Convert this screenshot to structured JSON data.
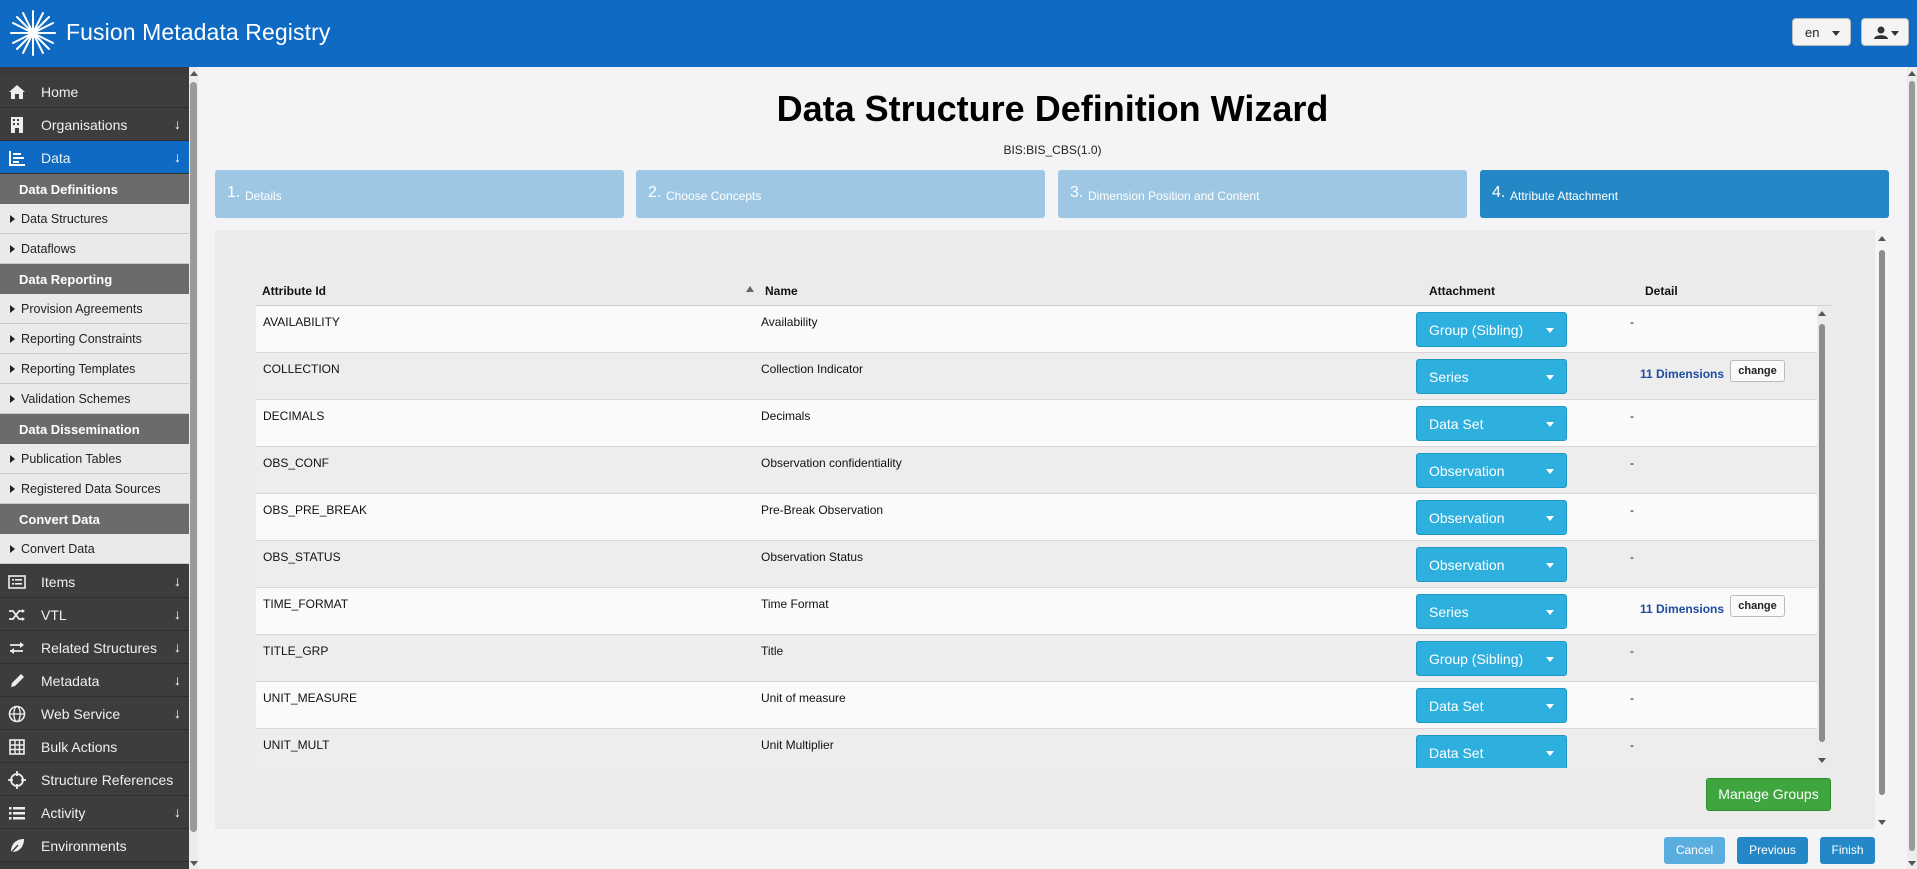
{
  "header": {
    "app_title": "Fusion Metadata Registry",
    "language": "en"
  },
  "sidebar": {
    "items_top": [
      {
        "label": "Home",
        "icon": "home-icon",
        "expand": false
      },
      {
        "label": "Organisations",
        "icon": "building-icon",
        "expand": true
      },
      {
        "label": "Data",
        "icon": "chart-icon",
        "expand": true,
        "active": true
      }
    ],
    "groups": [
      {
        "title": "Data Definitions",
        "items": [
          "Data Structures",
          "Dataflows"
        ]
      },
      {
        "title": "Data Reporting",
        "items": [
          "Provision Agreements",
          "Reporting Constraints",
          "Reporting Templates",
          "Validation Schemes"
        ]
      },
      {
        "title": "Data Dissemination",
        "items": [
          "Publication Tables",
          "Registered Data Sources"
        ]
      },
      {
        "title": "Convert Data",
        "items": [
          "Convert Data"
        ]
      }
    ],
    "items_bottom": [
      {
        "label": "Items",
        "icon": "list-icon",
        "expand": true
      },
      {
        "label": "VTL",
        "icon": "shuffle-icon",
        "expand": true
      },
      {
        "label": "Related Structures",
        "icon": "exchange-icon",
        "expand": true
      },
      {
        "label": "Metadata",
        "icon": "pencil-icon",
        "expand": true
      },
      {
        "label": "Web Service",
        "icon": "globe-icon",
        "expand": true
      },
      {
        "label": "Bulk Actions",
        "icon": "grid-icon",
        "expand": false
      },
      {
        "label": "Structure References",
        "icon": "crosshair-icon",
        "expand": false
      },
      {
        "label": "Activity",
        "icon": "list-icon",
        "expand": true
      },
      {
        "label": "Environments",
        "icon": "leaf-icon",
        "expand": false
      }
    ]
  },
  "wizard": {
    "title": "Data Structure Definition Wizard",
    "subtitle": "BIS:BIS_CBS(1.0)",
    "steps": [
      {
        "num": "1.",
        "label": "Details"
      },
      {
        "num": "2.",
        "label": "Choose Concepts"
      },
      {
        "num": "3.",
        "label": "Dimension Position and Content"
      },
      {
        "num": "4.",
        "label": "Attribute Attachment"
      }
    ]
  },
  "table": {
    "columns": {
      "id": "Attribute Id",
      "name": "Name",
      "attachment": "Attachment",
      "detail": "Detail"
    },
    "rows": [
      {
        "id": "AVAILABILITY",
        "name": "Availability",
        "attachment": "Group (Sibling)",
        "detail": "-"
      },
      {
        "id": "COLLECTION",
        "name": "Collection Indicator",
        "attachment": "Series",
        "dimensions": "11 Dimensions",
        "change": "change"
      },
      {
        "id": "DECIMALS",
        "name": "Decimals",
        "attachment": "Data Set",
        "detail": "-"
      },
      {
        "id": "OBS_CONF",
        "name": "Observation confidentiality",
        "attachment": "Observation",
        "detail": "-"
      },
      {
        "id": "OBS_PRE_BREAK",
        "name": "Pre-Break Observation",
        "attachment": "Observation",
        "detail": "-"
      },
      {
        "id": "OBS_STATUS",
        "name": "Observation Status",
        "attachment": "Observation",
        "detail": "-"
      },
      {
        "id": "TIME_FORMAT",
        "name": "Time Format",
        "attachment": "Series",
        "dimensions": "11 Dimensions",
        "change": "change"
      },
      {
        "id": "TITLE_GRP",
        "name": "Title",
        "attachment": "Group (Sibling)",
        "detail": "-"
      },
      {
        "id": "UNIT_MEASURE",
        "name": "Unit of measure",
        "attachment": "Data Set",
        "detail": "-"
      },
      {
        "id": "UNIT_MULT",
        "name": "Unit Multiplier",
        "attachment": "Data Set",
        "detail": "-"
      }
    ]
  },
  "actions": {
    "manage_groups": "Manage Groups",
    "cancel": "Cancel",
    "previous": "Previous",
    "finish": "Finish"
  }
}
